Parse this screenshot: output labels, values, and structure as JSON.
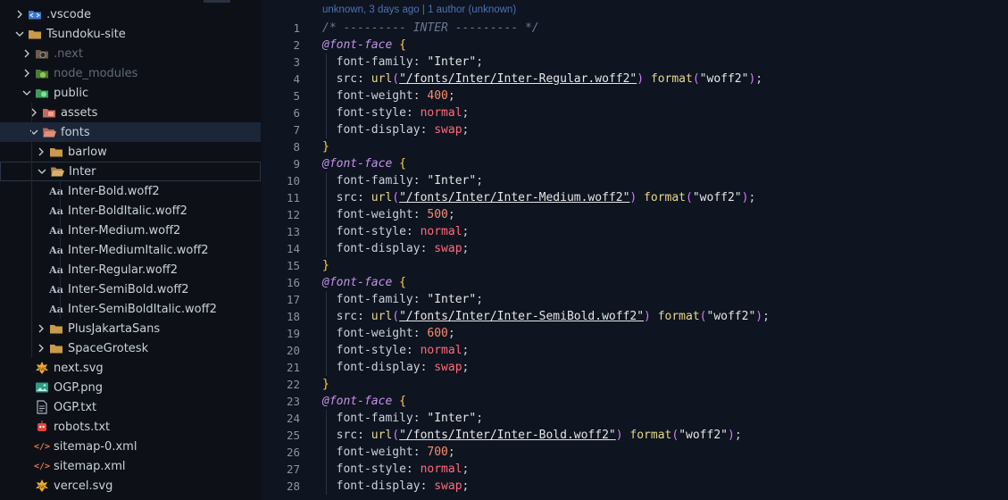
{
  "explorer": {
    "rows": [
      {
        "label": ".vscode",
        "kind": "folder-vscode",
        "chevron": "right",
        "indent": 0
      },
      {
        "label": "Tsundoku-site",
        "kind": "folder",
        "chevron": "down",
        "indent": 0
      },
      {
        "label": ".next",
        "kind": "folder-next",
        "chevron": "right",
        "indent": 1,
        "dim": true
      },
      {
        "label": "node_modules",
        "kind": "folder-node",
        "chevron": "right",
        "indent": 1,
        "dim": true
      },
      {
        "label": "public",
        "kind": "folder-public",
        "chevron": "down",
        "indent": 1
      },
      {
        "label": "assets",
        "kind": "folder-assets",
        "chevron": "right",
        "indent": 2
      },
      {
        "label": "fonts",
        "kind": "folder-fonts",
        "chevron": "down",
        "indent": 2,
        "selected": true
      },
      {
        "label": "barlow",
        "kind": "folder",
        "chevron": "right",
        "indent": 3
      },
      {
        "label": "Inter",
        "kind": "folder-open",
        "chevron": "down",
        "indent": 3,
        "focused": true
      },
      {
        "label": "Inter-Bold.woff2",
        "kind": "font",
        "indent": 4
      },
      {
        "label": "Inter-BoldItalic.woff2",
        "kind": "font",
        "indent": 4
      },
      {
        "label": "Inter-Medium.woff2",
        "kind": "font",
        "indent": 4
      },
      {
        "label": "Inter-MediumItalic.woff2",
        "kind": "font",
        "indent": 4
      },
      {
        "label": "Inter-Regular.woff2",
        "kind": "font",
        "indent": 4
      },
      {
        "label": "Inter-SemiBold.woff2",
        "kind": "font",
        "indent": 4
      },
      {
        "label": "Inter-SemiBoldItalic.woff2",
        "kind": "font",
        "indent": 4
      },
      {
        "label": "PlusJakartaSans",
        "kind": "folder",
        "chevron": "right",
        "indent": 3
      },
      {
        "label": "SpaceGrotesk",
        "kind": "folder",
        "chevron": "right",
        "indent": 3
      },
      {
        "label": "next.svg",
        "kind": "svg",
        "indent": 2
      },
      {
        "label": "OGP.png",
        "kind": "image",
        "indent": 2
      },
      {
        "label": "OGP.txt",
        "kind": "txt",
        "indent": 2
      },
      {
        "label": "robots.txt",
        "kind": "robots",
        "indent": 2
      },
      {
        "label": "sitemap-0.xml",
        "kind": "xml",
        "indent": 2
      },
      {
        "label": "sitemap.xml",
        "kind": "xml",
        "indent": 2
      },
      {
        "label": "vercel.svg",
        "kind": "svg",
        "indent": 2
      }
    ]
  },
  "editor": {
    "blame": "unknown, 3 days ago | 1 author (unknown)",
    "lines": [
      [
        [
          "comment",
          "/* --------- INTER --------- */"
        ]
      ],
      [
        [
          "at",
          "@font-face"
        ],
        [
          "punc",
          " "
        ],
        [
          "brace",
          "{"
        ]
      ],
      [
        [
          "prop",
          "  font-family: "
        ],
        [
          "str",
          "\"Inter\""
        ],
        [
          "punc",
          ";"
        ]
      ],
      [
        [
          "prop",
          "  src: "
        ],
        [
          "fn",
          "url"
        ],
        [
          "paren",
          "("
        ],
        [
          "url",
          "\"/fonts/Inter/Inter-Regular.woff2\""
        ],
        [
          "paren",
          ")"
        ],
        [
          "punc",
          " "
        ],
        [
          "fn",
          "format"
        ],
        [
          "paren",
          "("
        ],
        [
          "str",
          "\"woff2\""
        ],
        [
          "paren",
          ")"
        ],
        [
          "punc",
          ";"
        ]
      ],
      [
        [
          "prop",
          "  font-weight: "
        ],
        [
          "num",
          "400"
        ],
        [
          "punc",
          ";"
        ]
      ],
      [
        [
          "prop",
          "  font-style: "
        ],
        [
          "kw",
          "normal"
        ],
        [
          "punc",
          ";"
        ]
      ],
      [
        [
          "prop",
          "  font-display: "
        ],
        [
          "kw",
          "swap"
        ],
        [
          "punc",
          ";"
        ]
      ],
      [
        [
          "brace",
          "}"
        ]
      ],
      [
        [
          "at",
          "@font-face"
        ],
        [
          "punc",
          " "
        ],
        [
          "brace",
          "{"
        ]
      ],
      [
        [
          "prop",
          "  font-family: "
        ],
        [
          "str",
          "\"Inter\""
        ],
        [
          "punc",
          ";"
        ]
      ],
      [
        [
          "prop",
          "  src: "
        ],
        [
          "fn",
          "url"
        ],
        [
          "paren",
          "("
        ],
        [
          "url",
          "\"/fonts/Inter/Inter-Medium.woff2\""
        ],
        [
          "paren",
          ")"
        ],
        [
          "punc",
          " "
        ],
        [
          "fn",
          "format"
        ],
        [
          "paren",
          "("
        ],
        [
          "str",
          "\"woff2\""
        ],
        [
          "paren",
          ")"
        ],
        [
          "punc",
          ";"
        ]
      ],
      [
        [
          "prop",
          "  font-weight: "
        ],
        [
          "num",
          "500"
        ],
        [
          "punc",
          ";"
        ]
      ],
      [
        [
          "prop",
          "  font-style: "
        ],
        [
          "kw",
          "normal"
        ],
        [
          "punc",
          ";"
        ]
      ],
      [
        [
          "prop",
          "  font-display: "
        ],
        [
          "kw",
          "swap"
        ],
        [
          "punc",
          ";"
        ]
      ],
      [
        [
          "brace",
          "}"
        ]
      ],
      [
        [
          "at",
          "@font-face"
        ],
        [
          "punc",
          " "
        ],
        [
          "brace",
          "{"
        ]
      ],
      [
        [
          "prop",
          "  font-family: "
        ],
        [
          "str",
          "\"Inter\""
        ],
        [
          "punc",
          ";"
        ]
      ],
      [
        [
          "prop",
          "  src: "
        ],
        [
          "fn",
          "url"
        ],
        [
          "paren",
          "("
        ],
        [
          "url",
          "\"/fonts/Inter/Inter-SemiBold.woff2\""
        ],
        [
          "paren",
          ")"
        ],
        [
          "punc",
          " "
        ],
        [
          "fn",
          "format"
        ],
        [
          "paren",
          "("
        ],
        [
          "str",
          "\"woff2\""
        ],
        [
          "paren",
          ")"
        ],
        [
          "punc",
          ";"
        ]
      ],
      [
        [
          "prop",
          "  font-weight: "
        ],
        [
          "num",
          "600"
        ],
        [
          "punc",
          ";"
        ]
      ],
      [
        [
          "prop",
          "  font-style: "
        ],
        [
          "kw",
          "normal"
        ],
        [
          "punc",
          ";"
        ]
      ],
      [
        [
          "prop",
          "  font-display: "
        ],
        [
          "kw",
          "swap"
        ],
        [
          "punc",
          ";"
        ]
      ],
      [
        [
          "brace",
          "}"
        ]
      ],
      [
        [
          "at",
          "@font-face"
        ],
        [
          "punc",
          " "
        ],
        [
          "brace",
          "{"
        ]
      ],
      [
        [
          "prop",
          "  font-family: "
        ],
        [
          "str",
          "\"Inter\""
        ],
        [
          "punc",
          ";"
        ]
      ],
      [
        [
          "prop",
          "  src: "
        ],
        [
          "fn",
          "url"
        ],
        [
          "paren",
          "("
        ],
        [
          "url",
          "\"/fonts/Inter/Inter-Bold.woff2\""
        ],
        [
          "paren",
          ")"
        ],
        [
          "punc",
          " "
        ],
        [
          "fn",
          "format"
        ],
        [
          "paren",
          "("
        ],
        [
          "str",
          "\"woff2\""
        ],
        [
          "paren",
          ")"
        ],
        [
          "punc",
          ";"
        ]
      ],
      [
        [
          "prop",
          "  font-weight: "
        ],
        [
          "num",
          "700"
        ],
        [
          "punc",
          ";"
        ]
      ],
      [
        [
          "prop",
          "  font-style: "
        ],
        [
          "kw",
          "normal"
        ],
        [
          "punc",
          ";"
        ]
      ],
      [
        [
          "prop",
          "  font-display: "
        ],
        [
          "kw",
          "swap"
        ],
        [
          "punc",
          ";"
        ]
      ]
    ]
  },
  "colors": {
    "background": "#0d1117",
    "editor_background": "#0e1420",
    "selection": "#1b2638",
    "blame": "#4d73b4"
  }
}
